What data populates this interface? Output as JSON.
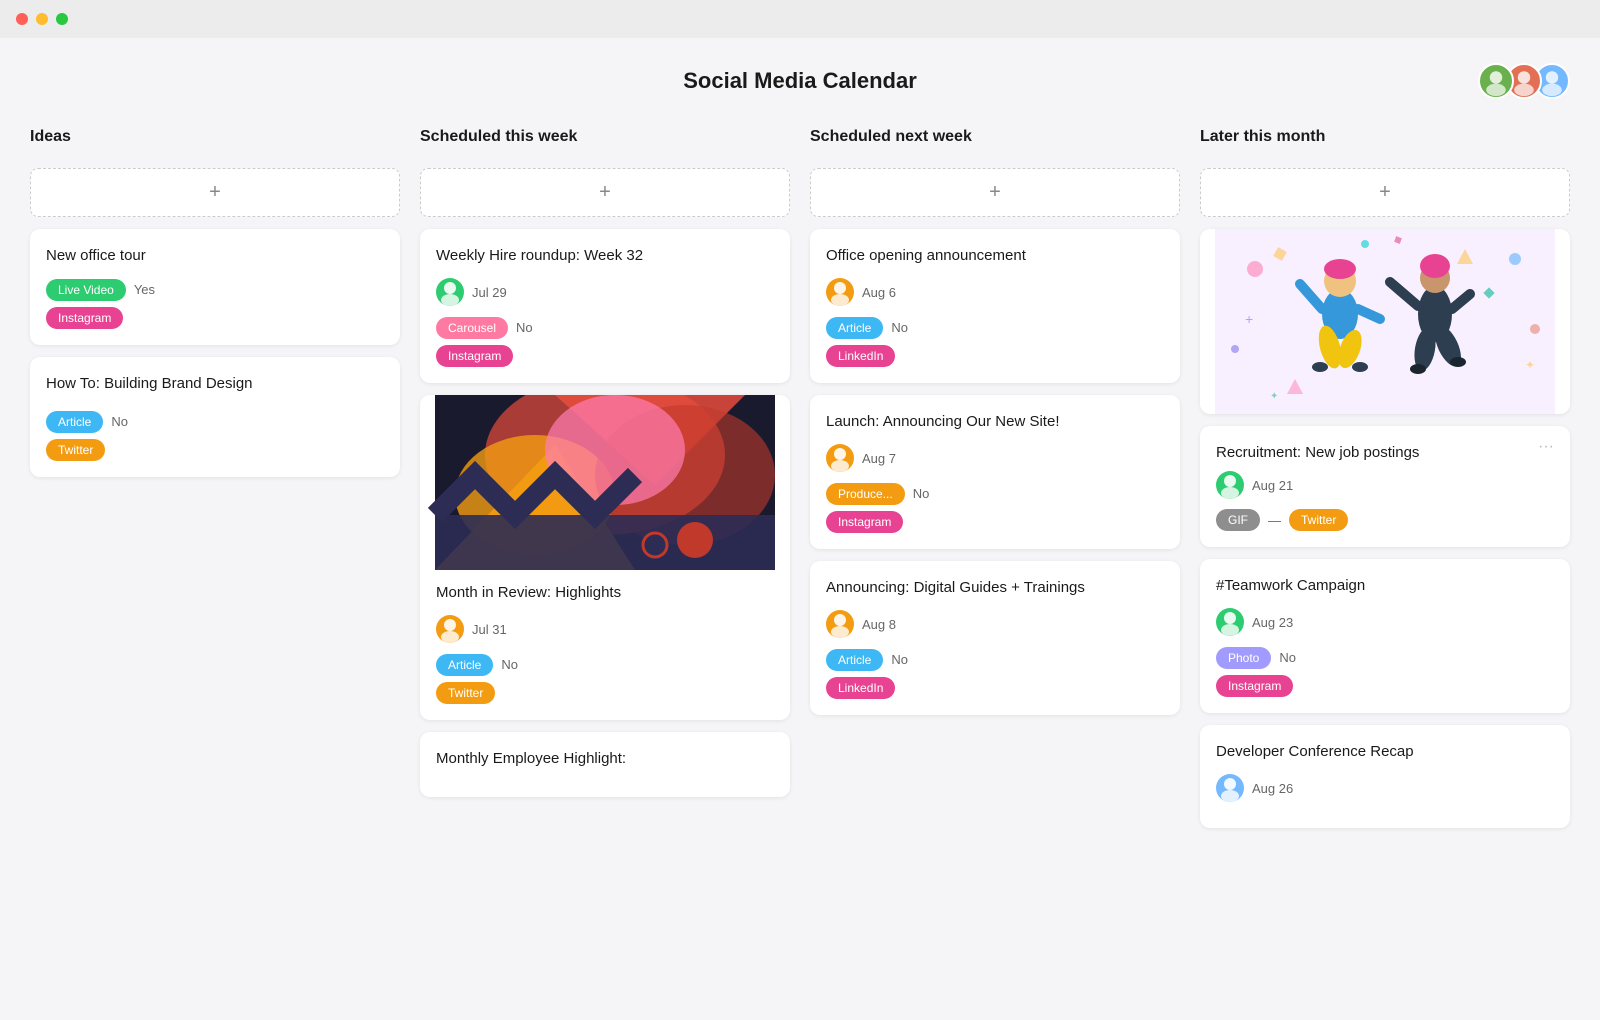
{
  "titlebar": {
    "lights": [
      "red",
      "yellow",
      "green"
    ]
  },
  "header": {
    "title": "Social Media Calendar"
  },
  "avatars": [
    {
      "id": "avatar-1",
      "label": "U1",
      "color": "#6ab04c"
    },
    {
      "id": "avatar-2",
      "label": "U2",
      "color": "#e17055"
    },
    {
      "id": "avatar-3",
      "label": "U3",
      "color": "#74b9ff"
    }
  ],
  "columns": [
    {
      "id": "ideas",
      "label": "Ideas"
    },
    {
      "id": "this-week",
      "label": "Scheduled this week"
    },
    {
      "id": "next-week",
      "label": "Scheduled next week"
    },
    {
      "id": "later",
      "label": "Later this month"
    }
  ],
  "add_button_label": "+",
  "cards": {
    "ideas": [
      {
        "id": "new-office-tour",
        "title": "New office tour",
        "tags": [
          "Live Video"
        ],
        "tag_classes": [
          "tag-live-video"
        ],
        "extra_label": "Yes",
        "extra_tags": [
          "Instagram"
        ],
        "extra_tag_classes": [
          "tag-instagram"
        ]
      },
      {
        "id": "building-brand",
        "title": "How To: Building Brand Design",
        "tags": [
          "Article"
        ],
        "tag_classes": [
          "tag-article"
        ],
        "extra_label": "No",
        "extra_tags": [
          "Twitter"
        ],
        "extra_tag_classes": [
          "tag-twitter"
        ]
      }
    ],
    "this_week": [
      {
        "id": "weekly-hire",
        "title": "Weekly Hire roundup: Week 32",
        "avatar_color": "#2ecc71",
        "date": "Jul 29",
        "tags": [
          "Carousel"
        ],
        "tag_classes": [
          "tag-carousel"
        ],
        "extra_label": "No",
        "extra_tags": [
          "Instagram"
        ],
        "extra_tag_classes": [
          "tag-instagram"
        ]
      },
      {
        "id": "month-review",
        "has_image": true,
        "image_type": "colorful",
        "title": "Month in Review: Highlights",
        "avatar_color": "#f39c12",
        "date": "Jul 31",
        "tags": [
          "Article"
        ],
        "tag_classes": [
          "tag-article"
        ],
        "extra_label": "No",
        "extra_tags": [
          "Twitter"
        ],
        "extra_tag_classes": [
          "tag-twitter"
        ]
      },
      {
        "id": "monthly-employee",
        "title": "Monthly Employee Highlight:",
        "partial": true
      }
    ],
    "next_week": [
      {
        "id": "office-opening",
        "title": "Office opening announcement",
        "avatar_color": "#f39c12",
        "date": "Aug 6",
        "tags": [
          "Article"
        ],
        "tag_classes": [
          "tag-article"
        ],
        "extra_label": "No",
        "extra_tags": [
          "LinkedIn"
        ],
        "extra_tag_classes": [
          "tag-linkedin"
        ]
      },
      {
        "id": "new-site",
        "title": "Launch: Announcing Our New Site!",
        "avatar_color": "#f39c12",
        "date": "Aug 7",
        "tags": [
          "Produce..."
        ],
        "tag_classes": [
          "tag-produce"
        ],
        "extra_label": "No",
        "extra_tags": [
          "Instagram"
        ],
        "extra_tag_classes": [
          "tag-instagram"
        ]
      },
      {
        "id": "digital-guides",
        "title": "Announcing: Digital Guides + Trainings",
        "avatar_color": "#f39c12",
        "date": "Aug 8",
        "tags": [
          "Article"
        ],
        "tag_classes": [
          "tag-article"
        ],
        "extra_label": "No",
        "extra_tags": [
          "LinkedIn"
        ],
        "extra_tag_classes": [
          "tag-linkedin"
        ]
      }
    ],
    "later": [
      {
        "id": "recruitment",
        "title": "Recruitment: New job postings",
        "avatar_color": "#2ecc71",
        "date": "Aug 21",
        "tags": [
          "GIF"
        ],
        "tag_classes": [
          "tag-gif"
        ],
        "extra_label": "—",
        "extra_tags": [
          "Twitter"
        ],
        "extra_tag_classes": [
          "tag-twitter"
        ]
      },
      {
        "id": "teamwork",
        "title": "#Teamwork Campaign",
        "avatar_color": "#2ecc71",
        "date": "Aug 23",
        "tags": [
          "Photo"
        ],
        "tag_classes": [
          "tag-photo"
        ],
        "extra_label": "No",
        "extra_tags": [
          "Instagram"
        ],
        "extra_tag_classes": [
          "tag-instagram"
        ]
      },
      {
        "id": "dev-conference",
        "title": "Developer Conference Recap",
        "avatar_color": "#74b9ff",
        "date": "Aug 26",
        "partial": true
      }
    ]
  }
}
